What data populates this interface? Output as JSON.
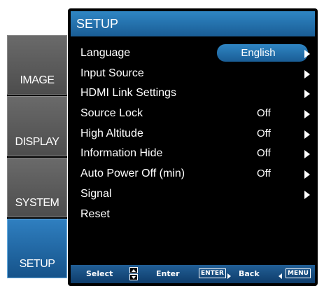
{
  "header": {
    "title": "SETUP"
  },
  "side_tabs": [
    {
      "label": "IMAGE",
      "active": false
    },
    {
      "label": "DISPLAY",
      "active": false
    },
    {
      "label": "SYSTEM",
      "active": false
    },
    {
      "label": "SETUP",
      "active": true
    }
  ],
  "menu": [
    {
      "label": "Language",
      "value": "English",
      "arrow": true,
      "selected": true
    },
    {
      "label": "Input Source",
      "value": "",
      "arrow": true
    },
    {
      "label": "HDMI Link Settings",
      "value": "",
      "arrow": true
    },
    {
      "label": "Source Lock",
      "value": "Off",
      "arrow": true
    },
    {
      "label": "High Altitude",
      "value": "Off",
      "arrow": true
    },
    {
      "label": "Information Hide",
      "value": "Off",
      "arrow": true
    },
    {
      "label": "Auto Power Off (min)",
      "value": "Off",
      "arrow": true
    },
    {
      "label": "Signal",
      "value": "",
      "arrow": true
    },
    {
      "label": "Reset",
      "value": "",
      "arrow": false
    }
  ],
  "footer": {
    "select_label": "Select",
    "enter_label": "Enter",
    "enter_key": "ENTER",
    "back_label": "Back",
    "menu_key": "MENU",
    "icons": [
      "up-down-icon",
      "right-arrow-icon",
      "left-arrow-icon"
    ]
  },
  "colors": {
    "accent": "#1f6aa8",
    "panel_bg": "#000000",
    "tab_bg": "#5a5a5a",
    "text": "#ffffff"
  }
}
